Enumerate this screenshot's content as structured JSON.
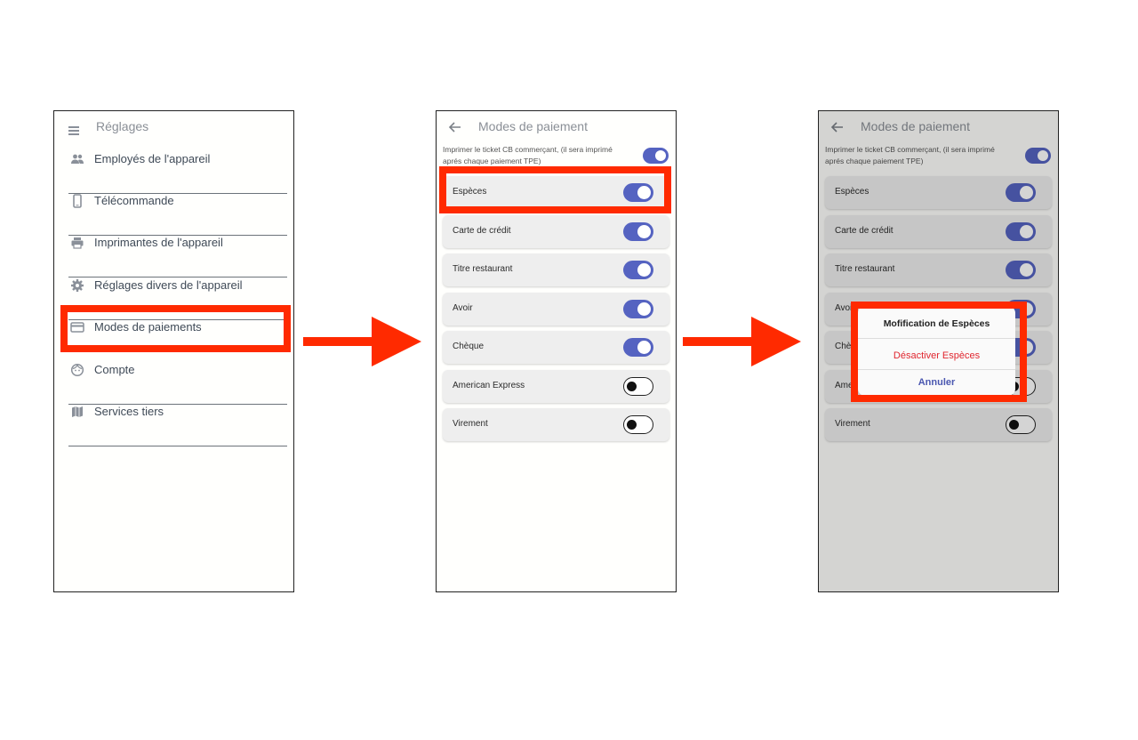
{
  "screen1": {
    "title": "Réglages",
    "items": [
      {
        "label": "Employés de l'appareil",
        "icon": "people-icon"
      },
      {
        "label": "Télécommande",
        "icon": "phone-icon"
      },
      {
        "label": "Imprimantes de l'appareil",
        "icon": "printer-icon"
      },
      {
        "label": "Réglages divers de l'appareil",
        "icon": "gear-icon"
      },
      {
        "label": "Modes de paiements",
        "icon": "credit-card-icon"
      },
      {
        "label": "Compte",
        "icon": "face-icon"
      },
      {
        "label": "Services tiers",
        "icon": "map-icon"
      }
    ]
  },
  "screen2": {
    "title": "Modes de paiement",
    "print_ticket_text": "Imprimer le ticket CB commerçant, (il sera imprimé aprés chaque paiement TPE)",
    "print_ticket_enabled": true,
    "payment_modes": [
      {
        "label": "Espèces",
        "enabled": true
      },
      {
        "label": "Carte de crédit",
        "enabled": true
      },
      {
        "label": "Titre restaurant",
        "enabled": true
      },
      {
        "label": "Avoir",
        "enabled": true
      },
      {
        "label": "Chèque",
        "enabled": true
      },
      {
        "label": "American Express",
        "enabled": false
      },
      {
        "label": "Virement",
        "enabled": false
      }
    ]
  },
  "screen3": {
    "title": "Modes de paiement",
    "dialog": {
      "title": "Mofification de Espèces",
      "deactivate_label": "Désactiver Espèces",
      "cancel_label": "Annuler"
    }
  },
  "colors": {
    "highlight": "#ff2a00",
    "toggle_on": "#5563c1",
    "danger_text": "#e0262f",
    "cancel_text": "#4a57b0"
  }
}
